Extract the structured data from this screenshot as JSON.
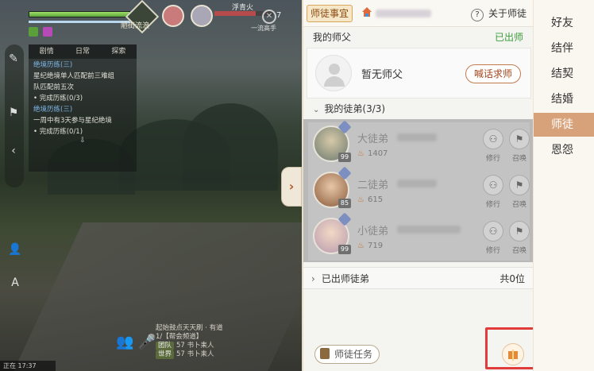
{
  "hud": {
    "crest_label": "陋街流浪",
    "enemy_name": "浮青火",
    "enemy_level": "7",
    "enemy_sub": "一流高手"
  },
  "quest": {
    "tabs": [
      "剧情",
      "日常",
      "探索"
    ],
    "lines": [
      "绝境历练(三)",
      "星纪绝境单人匹配前三难组",
      "队匹配前五次",
      "• 完成历练(0/3)",
      "绝境历练(三)",
      "一周中有3天参与星纪绝境",
      "• 完成历练(0/1)"
    ]
  },
  "chat": {
    "line1": "起始鼓点天天刷 · 有道",
    "line2": "1/【帮会频道】",
    "line3_tag": "团队",
    "line3": "57 书卜耒人",
    "line4_tag": "世界",
    "line4": "57 书卜耒人"
  },
  "clock": "正在 17:37",
  "panel": {
    "tab_label": "师徒事宜",
    "about_label": "关于师徒",
    "help_symbol": "?",
    "my_master_label": "我的师父",
    "graduated_label": "已出师",
    "no_master_text": "暂无师父",
    "call_master_button": "喊话求师",
    "my_apprentices_label": "我的徒弟(3/3)",
    "apprentices": [
      {
        "name": "大徒弟",
        "level": "99",
        "power": "1407",
        "cultivate": "修行",
        "summon": "召唤"
      },
      {
        "name": "二徒弟",
        "level": "85",
        "power": "615",
        "cultivate": "修行",
        "summon": "召唤"
      },
      {
        "name": "小徒弟",
        "level": "99",
        "power": "719",
        "cultivate": "修行",
        "summon": "召唤"
      }
    ],
    "former_label": "已出师徒弟",
    "former_count": "共0位",
    "task_button": "师徒任务"
  },
  "menu": {
    "items": [
      "好友",
      "结伴",
      "结契",
      "结婚",
      "师徒",
      "恩怨"
    ],
    "active": "师徒"
  },
  "colors": {
    "accent": "#d7a27a",
    "green": "#3c9b3a",
    "highlight": "#e23b3b"
  }
}
